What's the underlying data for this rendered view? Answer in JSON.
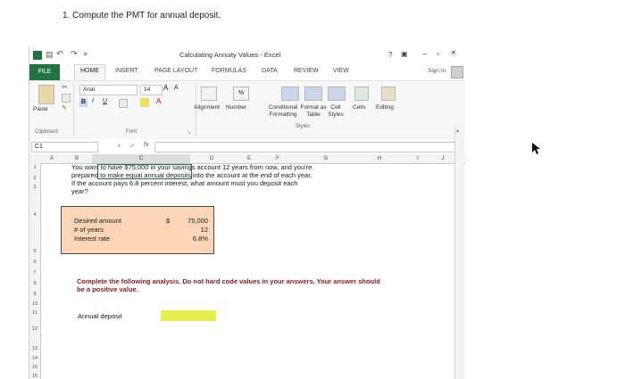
{
  "question": "1. Compute the PMT for annual deposit.",
  "window": {
    "title": "Calculating Annuity Values - Excel",
    "controls": {
      "help": "?",
      "restore_ribbon": "▣",
      "minimize": "–",
      "maximize": "▫",
      "close": "×"
    },
    "sign_in": "Sign In"
  },
  "tabs": [
    "FILE",
    "HOME",
    "INSERT",
    "PAGE LAYOUT",
    "FORMULAS",
    "DATA",
    "REVIEW",
    "VIEW"
  ],
  "ribbon": {
    "paste": "Paste",
    "clipboard": "Clipboard",
    "font_name": "Arial",
    "font_size": "14",
    "font_grow": "A",
    "font_shrink": "A",
    "bold": "B",
    "italic": "I",
    "underline": "U",
    "font_color": "A",
    "font_group": "Font",
    "alignment": "Alignment",
    "number": "Number",
    "percent": "%",
    "conditional_formatting": "Conditional Formatting",
    "format_as_table": "Format as Table",
    "cell_styles": "Cell Styles",
    "styles_group": "Styles",
    "cells": "Cells",
    "editing": "Editing"
  },
  "formula_bar": {
    "name_box": "C1",
    "cancel": "×",
    "enter": "✓",
    "fx": "fx",
    "value": ""
  },
  "columns": [
    "A",
    "B",
    "C",
    "D",
    "E",
    "F",
    "G",
    "H",
    "I",
    "J"
  ],
  "rows": [
    "1",
    "2",
    "3",
    "4",
    "5",
    "6",
    "7",
    "8",
    "9",
    "10",
    "11",
    "12",
    "13",
    "14",
    "15",
    "16"
  ],
  "sheet": {
    "prompt": "You want to have $75,000 in your savings account 12 years from now, and you're prepared to make equal annual deposits into the account at the end of each year. If the account pays 6.8 percent interest, what amount must you deposit each year?",
    "inputs": [
      {
        "label": "Desired amount",
        "currency": "$",
        "value": "75,000"
      },
      {
        "label": "# of years",
        "currency": "",
        "value": "12"
      },
      {
        "label": "Interest rate",
        "currency": "",
        "value": "6.8%"
      }
    ],
    "instruction": "Complete the following analysis. Do not hard code values in your answers. Your answer should be a positive value.",
    "output_label": "Annual deposit",
    "output_value": ""
  }
}
